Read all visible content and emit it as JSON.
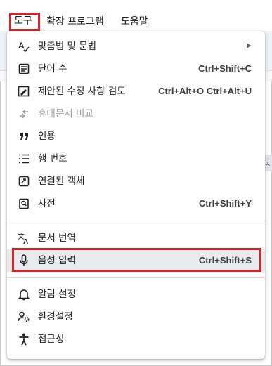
{
  "menubar": {
    "tools": "도구",
    "extensions": "확장 프로그램",
    "help": "도움말"
  },
  "background": {
    "side_char": "ㅈ"
  },
  "menu": {
    "spelling": "맞춤법 및 문법",
    "word_count": {
      "label": "단어 수",
      "shortcut": "Ctrl+Shift+C"
    },
    "review_edits": {
      "label": "제안된 수정 사항 검토",
      "shortcut": "Ctrl+Alt+O Ctrl+Alt+U"
    },
    "compare": "휴대문서 비교",
    "citations": "인용",
    "line_numbers": "행 번호",
    "linked_objects": "연결된 객체",
    "dictionary": {
      "label": "사전",
      "shortcut": "Ctrl+Shift+Y"
    },
    "translate": "문서 번역",
    "voice_typing": {
      "label": "음성 입력",
      "shortcut": "Ctrl+Shift+S"
    },
    "notifications": "알림 설정",
    "preferences": "환경설정",
    "accessibility": "접근성"
  },
  "colors": {
    "highlight": "#d9222a",
    "active_row": "#e8eaed"
  }
}
